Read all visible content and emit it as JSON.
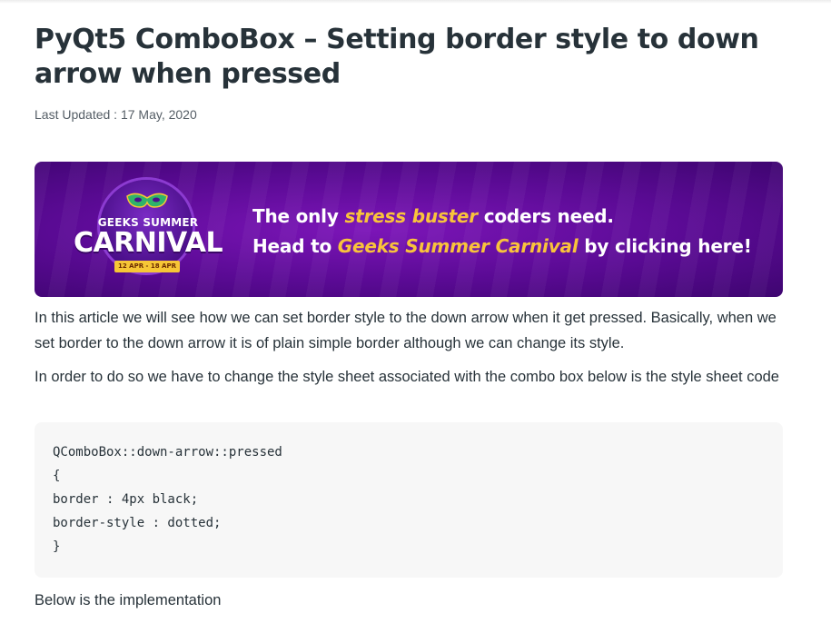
{
  "article": {
    "title": "PyQt5 ComboBox – Setting border style to down arrow when pressed",
    "last_updated": "Last Updated : 17 May, 2020"
  },
  "banner": {
    "logo_top": "GEEKS SUMMER",
    "logo_main": "CARNIVAL",
    "logo_dates": "12 APR - 18 APR",
    "line1_pre": "The only ",
    "line1_highlight": "stress buster",
    "line1_post": " coders need.",
    "line2_pre": "Head to ",
    "line2_highlight": "Geeks Summer Carnival",
    "line2_post": " by clicking here!",
    "colors": {
      "background": "#5a0a94",
      "highlight": "#f9c33b",
      "text": "#ffffff"
    }
  },
  "paragraphs": {
    "intro": "In this article we will see how we can set border style to the down arrow when it get pressed. Basically, when we set border to the down arrow it is of plain simple border although we can change its style.",
    "stylesheet_note": "In order to do so we have to change the style sheet associated with the combo box below is the style sheet code",
    "implementation": "Below is the implementation"
  },
  "code": {
    "lines": [
      "QComboBox::down-arrow::pressed",
      "{",
      "border : 4px black;",
      "border-style : dotted;",
      "}"
    ]
  }
}
